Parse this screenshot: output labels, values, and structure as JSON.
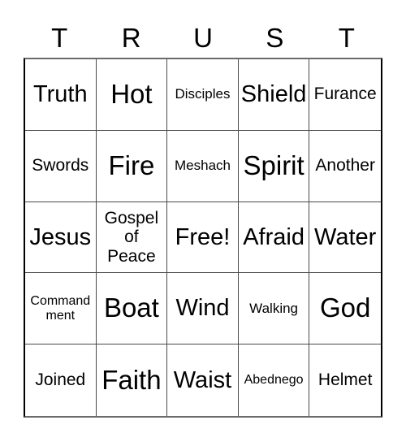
{
  "card": {
    "title_letters": [
      "T",
      "R",
      "U",
      "S",
      "T"
    ],
    "rows": [
      [
        {
          "label": "Truth",
          "size": "lg"
        },
        {
          "label": "Hot",
          "size": "xl"
        },
        {
          "label": "Disciples",
          "size": "xs"
        },
        {
          "label": "Shield",
          "size": "lg"
        },
        {
          "label": "Furance",
          "size": "sm"
        }
      ],
      [
        {
          "label": "Swords",
          "size": "sm"
        },
        {
          "label": "Fire",
          "size": "xl"
        },
        {
          "label": "Meshach",
          "size": "xs"
        },
        {
          "label": "Spirit",
          "size": "xl"
        },
        {
          "label": "Another",
          "size": "sm"
        }
      ],
      [
        {
          "label": "Jesus",
          "size": "lg"
        },
        {
          "label": "Gospel of Peace",
          "size": "sm",
          "multiline": true
        },
        {
          "label": "Free!",
          "size": "lg"
        },
        {
          "label": "Afraid",
          "size": "lg"
        },
        {
          "label": "Water",
          "size": "lg"
        }
      ],
      [
        {
          "label": "Commandment",
          "size": "xxs",
          "multiline": true
        },
        {
          "label": "Boat",
          "size": "xl"
        },
        {
          "label": "Wind",
          "size": "lg"
        },
        {
          "label": "Walking",
          "size": "xs"
        },
        {
          "label": "God",
          "size": "xl"
        }
      ],
      [
        {
          "label": "Joined",
          "size": "sm"
        },
        {
          "label": "Faith",
          "size": "xl"
        },
        {
          "label": "Waist",
          "size": "lg"
        },
        {
          "label": "Abednego",
          "size": "xxs"
        },
        {
          "label": "Helmet",
          "size": "sm"
        }
      ]
    ]
  },
  "colors": {
    "background": "#ffffff",
    "text": "#000000",
    "grid_line": "#4a4a4a",
    "outer_border": "#000000"
  }
}
